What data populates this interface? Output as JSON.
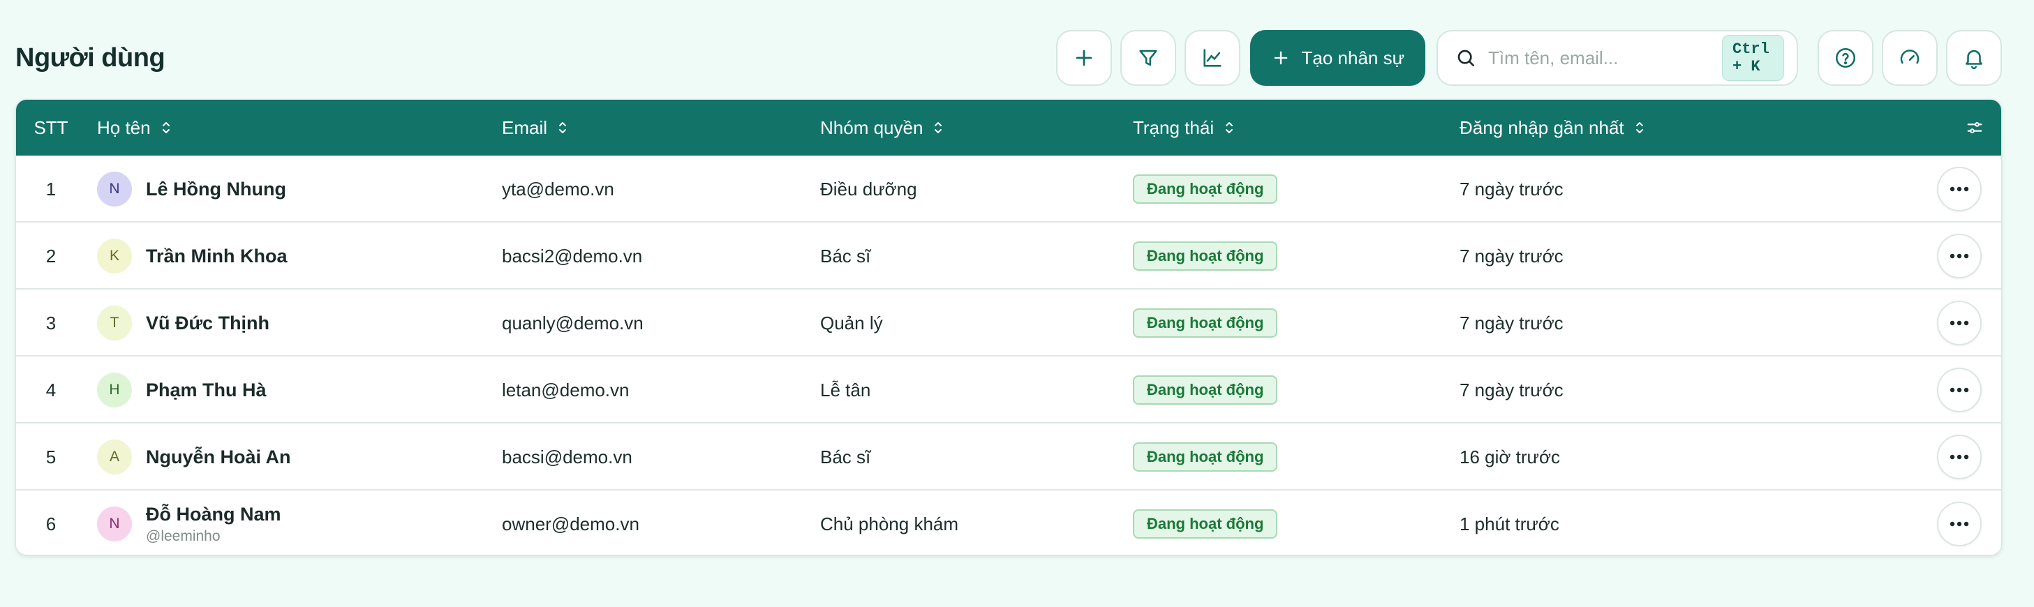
{
  "page": {
    "title": "Người dùng"
  },
  "toolbar": {
    "add_icon": "plus-icon",
    "filter_icon": "filter-icon",
    "chart_icon": "line-chart-icon",
    "create_label": "Tạo nhân sự",
    "search_placeholder": "Tìm tên, email...",
    "search_value": "",
    "shortcut": "Ctrl + K",
    "help_icon": "help-icon",
    "speed_icon": "gauge-icon",
    "bell_icon": "bell-icon"
  },
  "colors": {
    "primary": "#127369",
    "background": "#effbf7",
    "status_bg": "#e3f6e7",
    "status_text": "#1c7a3a"
  },
  "table": {
    "columns": {
      "stt": "STT",
      "name": "Họ tên",
      "email": "Email",
      "group": "Nhóm quyền",
      "status": "Trạng thái",
      "last_login": "Đăng nhập gần nhất"
    },
    "rows": [
      {
        "stt": "1",
        "initial": "N",
        "avatar_bg": "#d6d4f5",
        "avatar_fg": "#3b3a8a",
        "name": "Lê Hồng Nhung",
        "username": "",
        "email": "yta@demo.vn",
        "group": "Điều dưỡng",
        "status": "Đang hoạt động",
        "last_login": "7 ngày trước"
      },
      {
        "stt": "2",
        "initial": "K",
        "avatar_bg": "#f3f5cf",
        "avatar_fg": "#6d6a23",
        "name": "Trần Minh Khoa",
        "username": "",
        "email": "bacsi2@demo.vn",
        "group": "Bác sĩ",
        "status": "Đang hoạt động",
        "last_login": "7 ngày trước"
      },
      {
        "stt": "3",
        "initial": "T",
        "avatar_bg": "#eef6d3",
        "avatar_fg": "#5d6b27",
        "name": "Vũ Đức Thịnh",
        "username": "",
        "email": "quanly@demo.vn",
        "group": "Quản lý",
        "status": "Đang hoạt động",
        "last_login": "7 ngày trước"
      },
      {
        "stt": "4",
        "initial": "H",
        "avatar_bg": "#ddf5d5",
        "avatar_fg": "#2f6b2b",
        "name": "Phạm Thu Hà",
        "username": "",
        "email": "letan@demo.vn",
        "group": "Lễ tân",
        "status": "Đang hoạt động",
        "last_login": "7 ngày trước"
      },
      {
        "stt": "5",
        "initial": "A",
        "avatar_bg": "#f1f5d2",
        "avatar_fg": "#66692a",
        "name": "Nguyễn Hoài An",
        "username": "",
        "email": "bacsi@demo.vn",
        "group": "Bác sĩ",
        "status": "Đang hoạt động",
        "last_login": "16 giờ trước"
      },
      {
        "stt": "6",
        "initial": "N",
        "avatar_bg": "#f8d3ec",
        "avatar_fg": "#8a2e6e",
        "name": "Đỗ Hoàng Nam",
        "username": "@leeminho",
        "email": "owner@demo.vn",
        "group": "Chủ phòng khám",
        "status": "Đang hoạt động",
        "last_login": "1 phút trước"
      }
    ]
  }
}
